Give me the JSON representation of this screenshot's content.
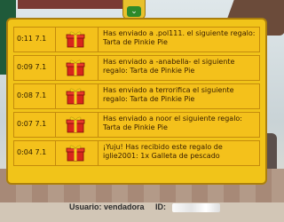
{
  "colors": {
    "panel": "#f1c419",
    "panel_border": "#ab7f0d",
    "text": "#3a2000",
    "arrow_button": "#2e8a2a"
  },
  "scroll_button": {
    "icon": "chevron-down-icon",
    "glyph": "⌄"
  },
  "notifications": [
    {
      "time": "0:11 7.1",
      "icon": "gift-icon",
      "message": "Has enviado a .pol111. el siguiente regalo: Tarta de Pinkie Pie"
    },
    {
      "time": "0:09 7.1",
      "icon": "gift-icon",
      "message": "Has enviado a -anabella- el siguiente regalo: Tarta de Pinkie Pie"
    },
    {
      "time": "0:08 7.1",
      "icon": "gift-icon",
      "message": "Has enviado a terrorifica el siguiente regalo: Tarta de Pinkie Pie"
    },
    {
      "time": "0:07 7.1",
      "icon": "gift-icon",
      "message": "Has enviado a noor el siguiente regalo: Tarta de Pinkie Pie"
    },
    {
      "time": "0:04 7.1",
      "icon": "gift-icon",
      "message": "¡Yuju! Has recibido este regalo de iglie2001: 1x Galleta de pescado"
    }
  ],
  "userbar": {
    "user_label": "Usuario: vendadora",
    "id_label": "ID:"
  }
}
